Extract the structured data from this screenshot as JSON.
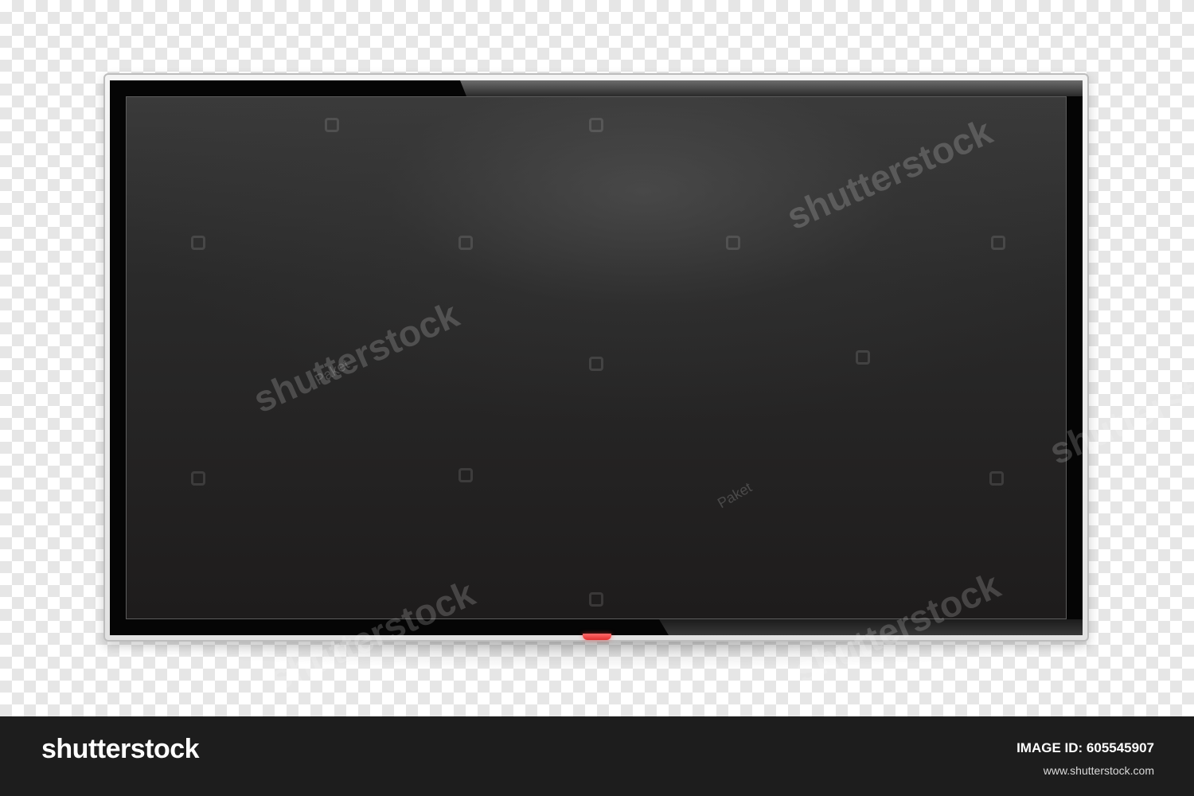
{
  "image": {
    "subject": "Blank flat-screen TV on transparent background",
    "colors": {
      "checker_light": "#ffffff",
      "checker_dark": "#e6e6e6",
      "screen": "#2a2a2a",
      "bezel": "#050505",
      "frame": "#e2e2e2",
      "power_led": "#e23030",
      "footer_bg": "#1d1d1d"
    }
  },
  "watermark": {
    "brand": "shutterstock",
    "contributor": "Paket"
  },
  "footer": {
    "logo": "shutterstock",
    "id_label": "IMAGE ID:",
    "id_value": "605545907",
    "id_text": "IMAGE ID: 605545907",
    "url": "www.shutterstock.com"
  }
}
